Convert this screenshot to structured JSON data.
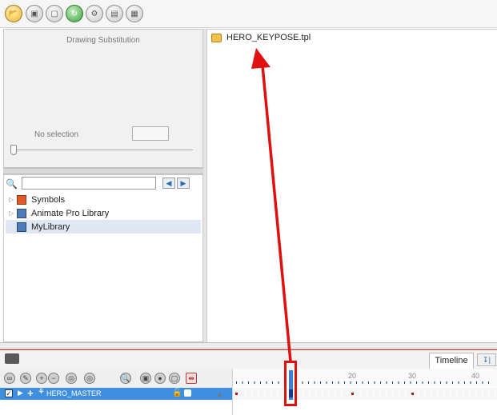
{
  "toolbar": {
    "icons": [
      "folder-open-icon",
      "save-icon",
      "copy-icon",
      "refresh-icon",
      "settings-icon",
      "grid-icon",
      "library-icon"
    ]
  },
  "drawing_substitution": {
    "title": "Drawing Substitution",
    "status": "No selection"
  },
  "library": {
    "search_placeholder": "",
    "items": [
      {
        "label": "Symbols",
        "icon": "symbols-folder-icon"
      },
      {
        "label": "Animate Pro Library",
        "icon": "library-folder-icon"
      },
      {
        "label": "MyLibrary",
        "icon": "library-folder-icon",
        "selected": true
      }
    ]
  },
  "file_panel": {
    "items": [
      {
        "label": "HERO_KEYPOSE.tpl",
        "icon": "template-folder-icon"
      }
    ]
  },
  "timeline": {
    "tab_label": "Timeline",
    "layer_name": "HERO_MASTER",
    "frame_numbers": [
      "20",
      "30",
      "40"
    ],
    "current_frame": 10
  },
  "annotation": {
    "color": "#e01010"
  }
}
